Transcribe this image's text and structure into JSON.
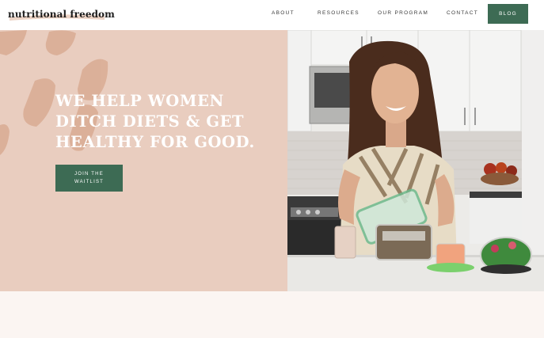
{
  "brand": {
    "logo_text": "nutritional freedom"
  },
  "nav": {
    "about": "ABOUT",
    "resources": "RESOURCES",
    "program": "OUR PROGRAM",
    "contact": "CONTACT",
    "blog": "BLOG"
  },
  "hero": {
    "headline_lines": [
      "WE HELP WOMEN",
      "DITCH DIETS & GET",
      "HEALTHY FOR GOOD."
    ],
    "cta_line1": "JOIN THE",
    "cta_line2": "WAITLIST"
  },
  "colors": {
    "accent_green": "#3d6b54",
    "hero_blush": "#e9cdbf",
    "footer_cream": "#fbf5f2"
  }
}
